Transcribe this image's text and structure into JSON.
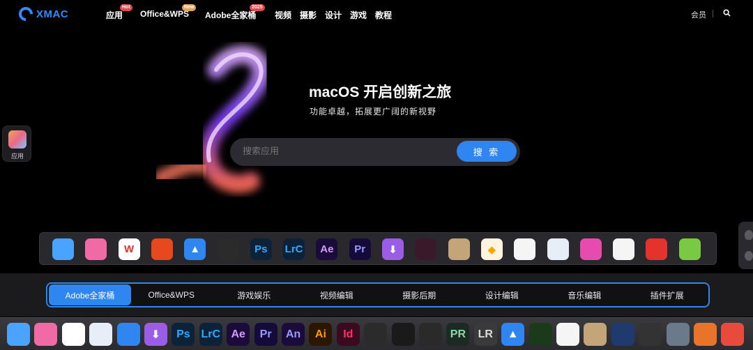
{
  "nav": {
    "logo": "XMAC",
    "items": [
      {
        "label": "应用",
        "badge": "Hot"
      },
      {
        "label": "Office&WPS",
        "badge": "New"
      },
      {
        "label": "Adobe全家桶",
        "badge": "2025"
      },
      {
        "label": "视频"
      },
      {
        "label": "摄影"
      },
      {
        "label": "设计"
      },
      {
        "label": "游戏"
      },
      {
        "label": "教程"
      }
    ],
    "member": "会员"
  },
  "hero": {
    "title": "macOS 开启创新之旅",
    "subtitle": "功能卓越，拓展更广阔的新视野",
    "search_placeholder": "搜索应用",
    "search_button": "搜 索"
  },
  "side": {
    "apps_label": "应用"
  },
  "dock1": {
    "icons": [
      {
        "name": "finder-icon",
        "text": "",
        "bg": "#4aa3ff",
        "fg": "#fff"
      },
      {
        "name": "screens-icon",
        "text": "",
        "bg": "#f06aa5",
        "fg": "#fff"
      },
      {
        "name": "wps-icon",
        "text": "W",
        "bg": "#ffffff",
        "fg": "#e5322d"
      },
      {
        "name": "office-icon",
        "text": "",
        "bg": "#e8481e",
        "fg": "#fff"
      },
      {
        "name": "mountain-icon",
        "text": "▲",
        "bg": "#2f86f0",
        "fg": "#fff"
      },
      {
        "name": "davinci-icon",
        "text": "",
        "bg": "#2b2b2b",
        "fg": "#fff"
      },
      {
        "name": "photoshop-icon",
        "text": "Ps",
        "bg": "#0b2239",
        "fg": "#31a8ff"
      },
      {
        "name": "lightroom-classic-icon",
        "text": "LrC",
        "bg": "#0b2239",
        "fg": "#31a8ff"
      },
      {
        "name": "after-effects-icon",
        "text": "Ae",
        "bg": "#1a0b3a",
        "fg": "#d49bff"
      },
      {
        "name": "premiere-icon",
        "text": "Pr",
        "bg": "#140b3a",
        "fg": "#9999ff"
      },
      {
        "name": "downie-icon",
        "text": "⬇",
        "bg": "#9b5de5",
        "fg": "#fff"
      },
      {
        "name": "davinci-resolve-icon",
        "text": "",
        "bg": "#3a1a2a",
        "fg": "#fff"
      },
      {
        "name": "archiver-icon",
        "text": "",
        "bg": "#c4a57a",
        "fg": "#fff"
      },
      {
        "name": "sketch-icon",
        "text": "◆",
        "bg": "#fff4e0",
        "fg": "#f7a600"
      },
      {
        "name": "pixelmator-icon",
        "text": "",
        "bg": "#f5f5f5",
        "fg": "#e55"
      },
      {
        "name": "parallels-icon",
        "text": "",
        "bg": "#e8eef7",
        "fg": "#d22"
      },
      {
        "name": "istat-icon",
        "text": "",
        "bg": "#e84bb0",
        "fg": "#fff"
      },
      {
        "name": "affinity-icon",
        "text": "",
        "bg": "#f5f5f5",
        "fg": "#9b5de5"
      },
      {
        "name": "pdf-icon",
        "text": "",
        "bg": "#e5322d",
        "fg": "#fff"
      },
      {
        "name": "cleaner-icon",
        "text": "",
        "bg": "#7ac943",
        "fg": "#fff"
      }
    ]
  },
  "tabs": [
    {
      "label": "Adobe全家桶",
      "active": true
    },
    {
      "label": "Office&WPS"
    },
    {
      "label": "游戏娱乐"
    },
    {
      "label": "视频编辑"
    },
    {
      "label": "摄影后期"
    },
    {
      "label": "设计编辑"
    },
    {
      "label": "音乐编辑"
    },
    {
      "label": "插件扩展"
    }
  ],
  "dock2": {
    "icons": [
      {
        "name": "finder-icon",
        "text": "",
        "bg": "#4aa3ff",
        "fg": "#fff"
      },
      {
        "name": "screens-icon",
        "text": "",
        "bg": "#f06aa5",
        "fg": "#fff"
      },
      {
        "name": "office-icon",
        "text": "",
        "bg": "#ffffff",
        "fg": "#e8481e"
      },
      {
        "name": "parallels-icon",
        "text": "",
        "bg": "#e8eef7",
        "fg": "#2f86f0"
      },
      {
        "name": "sync-icon",
        "text": "",
        "bg": "#2f86f0",
        "fg": "#fff"
      },
      {
        "name": "downie-icon",
        "text": "⬇",
        "bg": "#9b5de5",
        "fg": "#fff"
      },
      {
        "name": "photoshop-icon",
        "text": "Ps",
        "bg": "#0b2239",
        "fg": "#31a8ff"
      },
      {
        "name": "lightroom-classic-icon",
        "text": "LrC",
        "bg": "#0b2239",
        "fg": "#31a8ff"
      },
      {
        "name": "after-effects-icon",
        "text": "Ae",
        "bg": "#1a0b3a",
        "fg": "#d49bff"
      },
      {
        "name": "premiere-icon",
        "text": "Pr",
        "bg": "#140b3a",
        "fg": "#9999ff"
      },
      {
        "name": "animate-icon",
        "text": "An",
        "bg": "#1a0b3a",
        "fg": "#9999ff"
      },
      {
        "name": "illustrator-icon",
        "text": "Ai",
        "bg": "#2b1600",
        "fg": "#ff9a00"
      },
      {
        "name": "indesign-icon",
        "text": "Id",
        "bg": "#3a0b1e",
        "fg": "#ff3366"
      },
      {
        "name": "davinci-icon",
        "text": "",
        "bg": "#2b2b2b",
        "fg": "#fff"
      },
      {
        "name": "final-cut-icon",
        "text": "",
        "bg": "#1a1a1a",
        "fg": "#fff"
      },
      {
        "name": "frame-icon",
        "text": "",
        "bg": "#2a2a2a",
        "fg": "#e5322d"
      },
      {
        "name": "dxo-icon",
        "text": "PR",
        "bg": "#1c2a24",
        "fg": "#8fd6a8"
      },
      {
        "name": "lr-book-icon",
        "text": "LR",
        "bg": "#3a3a3a",
        "fg": "#ddd"
      },
      {
        "name": "mountain-icon",
        "text": "▲",
        "bg": "#2f86f0",
        "fg": "#fff"
      },
      {
        "name": "corel-icon",
        "text": "",
        "bg": "#1a3a1a",
        "fg": "#7ac943"
      },
      {
        "name": "pixelmator-icon",
        "text": "",
        "bg": "#f5f5f5",
        "fg": "#e55"
      },
      {
        "name": "archiver-icon",
        "text": "",
        "bg": "#c4a57a",
        "fg": "#fff"
      },
      {
        "name": "cinema4d-icon",
        "text": "",
        "bg": "#1e3a6e",
        "fg": "#fff"
      },
      {
        "name": "compressor-icon",
        "text": "",
        "bg": "#333",
        "fg": "#fff"
      },
      {
        "name": "robot-icon",
        "text": "",
        "bg": "#6a7a8a",
        "fg": "#fff"
      },
      {
        "name": "brush-icon",
        "text": "",
        "bg": "#e8742a",
        "fg": "#fff"
      },
      {
        "name": "xmind-icon",
        "text": "",
        "bg": "#e84b3c",
        "fg": "#fff"
      }
    ]
  }
}
